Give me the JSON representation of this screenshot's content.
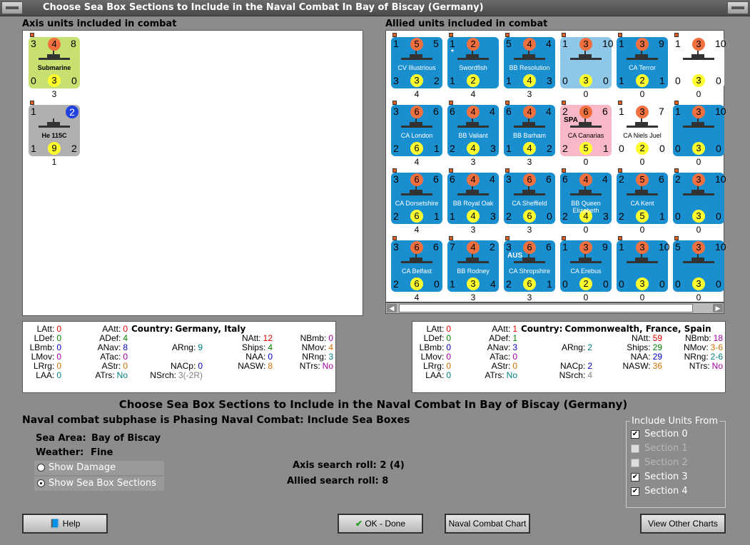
{
  "window": {
    "title": "Choose Sea Box Sections to Include in the Naval Combat In Bay of Biscay (Germany)"
  },
  "axis_panel": {
    "label": "Axis units included in combat",
    "units": [
      {
        "name": "Submarine",
        "tl": "3",
        "tc": "4",
        "tr": "8",
        "bl": "0",
        "bc": "3",
        "br": "0",
        "under": "3",
        "bg": "#c8e070",
        "tc_color": "#f07040",
        "bc_color": "#ffff30",
        "dark": true
      },
      {
        "name": "He 115C",
        "tl": "1",
        "tc": "",
        "tr": "2",
        "bl": "1",
        "bc": "9",
        "br": "2",
        "under": "1",
        "bg": "#b0b0b0",
        "tr_color": "#2040e0",
        "bc_color": "#ffff30",
        "dark": true
      }
    ]
  },
  "allied_panel": {
    "label": "Allied units included in combat",
    "units": [
      {
        "name": "CV Illustrious",
        "tl": "1",
        "tc": "5",
        "tr": "5",
        "bl": "3",
        "bc": "3",
        "br": "2",
        "under": "4",
        "bg": "#1a8fd0"
      },
      {
        "name": "Swordfish",
        "tl": "1",
        "tc": "2",
        "tr": "",
        "bl": "1",
        "bc": "2",
        "br": "",
        "under": "4",
        "bg": "#1a8fd0",
        "tag": "*"
      },
      {
        "name": "BB Resolution",
        "tl": "5",
        "tc": "4",
        "tr": "4",
        "bl": "1",
        "bc": "4",
        "br": "3",
        "under": "3",
        "bg": "#1a8fd0"
      },
      {
        "name": "",
        "tl": "1",
        "tc": "3",
        "tr": "10",
        "bl": "0",
        "bc": "3",
        "br": "0",
        "under": "0",
        "bg": "#8ec7e8"
      },
      {
        "name": "CA Terror",
        "tl": "1",
        "tc": "3",
        "tr": "9",
        "bl": "1",
        "bc": "2",
        "br": "1",
        "under": "0",
        "bg": "#1a8fd0"
      },
      {
        "name": "",
        "tl": "1",
        "tc": "3",
        "tr": "10",
        "bl": "0",
        "bc": "3",
        "br": "0",
        "under": "0",
        "bg": "#ffffff"
      },
      {
        "name": "CA London",
        "tl": "3",
        "tc": "6",
        "tr": "6",
        "bl": "2",
        "bc": "6",
        "br": "1",
        "under": "4",
        "bg": "#1a8fd0"
      },
      {
        "name": "BB Valiant",
        "tl": "6",
        "tc": "4",
        "tr": "4",
        "bl": "2",
        "bc": "4",
        "br": "3",
        "under": "3",
        "bg": "#1a8fd0"
      },
      {
        "name": "BB Barham",
        "tl": "6",
        "tc": "4",
        "tr": "4",
        "bl": "1",
        "bc": "4",
        "br": "2",
        "under": "3",
        "bg": "#1a8fd0"
      },
      {
        "name": "CA Canarias",
        "tl": "2",
        "tc": "6",
        "tr": "6",
        "bl": "2",
        "bc": "5",
        "br": "1",
        "under": "0",
        "bg": "#f8b8c8",
        "tag": "SPA"
      },
      {
        "name": "CA Niels Juel",
        "tl": "1",
        "tc": "3",
        "tr": "7",
        "bl": "0",
        "bc": "2",
        "br": "0",
        "under": "0",
        "bg": "#ffffff"
      },
      {
        "name": "",
        "tl": "1",
        "tc": "3",
        "tr": "10",
        "bl": "0",
        "bc": "3",
        "br": "0",
        "under": "0",
        "bg": "#1a8fd0"
      },
      {
        "name": "CA Dorsetshire",
        "tl": "3",
        "tc": "6",
        "tr": "6",
        "bl": "2",
        "bc": "6",
        "br": "1",
        "under": "4",
        "bg": "#1a8fd0"
      },
      {
        "name": "BB Royal Oak",
        "tl": "6",
        "tc": "4",
        "tr": "4",
        "bl": "1",
        "bc": "4",
        "br": "3",
        "under": "3",
        "bg": "#1a8fd0"
      },
      {
        "name": "CA Sheffield",
        "tl": "3",
        "tc": "6",
        "tr": "6",
        "bl": "2",
        "bc": "6",
        "br": "0",
        "under": "3",
        "bg": "#1a8fd0"
      },
      {
        "name": "BB Queen Elizabeth",
        "tl": "6",
        "tc": "4",
        "tr": "4",
        "bl": "2",
        "bc": "4",
        "br": "3",
        "under": "0",
        "bg": "#1a8fd0"
      },
      {
        "name": "CA Kent",
        "tl": "2",
        "tc": "5",
        "tr": "6",
        "bl": "2",
        "bc": "5",
        "br": "1",
        "under": "0",
        "bg": "#1a8fd0"
      },
      {
        "name": "",
        "tl": "2",
        "tc": "3",
        "tr": "10",
        "bl": "0",
        "bc": "3",
        "br": "0",
        "under": "0",
        "bg": "#1a8fd0"
      },
      {
        "name": "CA Belfast",
        "tl": "3",
        "tc": "6",
        "tr": "6",
        "bl": "2",
        "bc": "6",
        "br": "0",
        "under": "4",
        "bg": "#1a8fd0"
      },
      {
        "name": "BB Rodney",
        "tl": "7",
        "tc": "4",
        "tr": "2",
        "bl": "1",
        "bc": "3",
        "br": "4",
        "under": "3",
        "bg": "#1a8fd0"
      },
      {
        "name": "CA Shropshire",
        "tl": "3",
        "tc": "6",
        "tr": "6",
        "bl": "2",
        "bc": "6",
        "br": "1",
        "under": "3",
        "bg": "#1a8fd0",
        "tag": "AUS"
      },
      {
        "name": "CA Erebus",
        "tl": "1",
        "tc": "3",
        "tr": "9",
        "bl": "0",
        "bc": "2",
        "br": "0",
        "under": "0",
        "bg": "#1a8fd0"
      },
      {
        "name": "",
        "tl": "1",
        "tc": "3",
        "tr": "10",
        "bl": "0",
        "bc": "3",
        "br": "0",
        "under": "0",
        "bg": "#1a8fd0"
      },
      {
        "name": "",
        "tl": "5",
        "tc": "3",
        "tr": "10",
        "bl": "0",
        "bc": "3",
        "br": "0",
        "under": "0",
        "bg": "#1a8fd0"
      }
    ]
  },
  "axis_stats": {
    "country_label": "Country:",
    "country": "Germany, Italy",
    "items": [
      [
        "LAtt:",
        "0"
      ],
      [
        "LDef:",
        "0"
      ],
      [
        "LBmb:",
        "0"
      ],
      [
        "LMov:",
        "0"
      ],
      [
        "LRrg:",
        "0"
      ],
      [
        "LAA:",
        "0"
      ],
      [
        "AAtt:",
        "0"
      ],
      [
        "ADef:",
        "4"
      ],
      [
        "ANav:",
        "8"
      ],
      [
        "ATac:",
        "0"
      ],
      [
        "AStr:",
        "0"
      ],
      [
        "ATrs:",
        "No"
      ],
      [
        "ARng:",
        "9"
      ],
      [
        "NACp:",
        "0"
      ],
      [
        "NSrch:",
        "3(-2R)"
      ],
      [
        "NAtt:",
        "12"
      ],
      [
        "Ships:",
        "4"
      ],
      [
        "NAA:",
        "0"
      ],
      [
        "NASW:",
        "8"
      ],
      [
        "NBmb:",
        "0"
      ],
      [
        "NMov:",
        "4"
      ],
      [
        "NRng:",
        "3"
      ],
      [
        "NTrs:",
        "No"
      ]
    ]
  },
  "allied_stats": {
    "country_label": "Country:",
    "country": "Commonwealth, France, Spain",
    "items": [
      [
        "LAtt:",
        "0"
      ],
      [
        "LDef:",
        "0"
      ],
      [
        "LBmb:",
        "0"
      ],
      [
        "LMov:",
        "0"
      ],
      [
        "LRrg:",
        "0"
      ],
      [
        "LAA:",
        "0"
      ],
      [
        "AAtt:",
        "1"
      ],
      [
        "ADef:",
        "1"
      ],
      [
        "ANav:",
        "3"
      ],
      [
        "ATac:",
        "0"
      ],
      [
        "AStr:",
        "0"
      ],
      [
        "ATrs:",
        "No"
      ],
      [
        "ARng:",
        "2"
      ],
      [
        "NACp:",
        "2"
      ],
      [
        "NSrch:",
        "4"
      ],
      [
        "NAtt:",
        "59"
      ],
      [
        "Ships:",
        "29"
      ],
      [
        "NAA:",
        "29"
      ],
      [
        "NASW:",
        "36"
      ],
      [
        "NBmb:",
        "18"
      ],
      [
        "NMov:",
        "3-6"
      ],
      [
        "NRng:",
        "2-6"
      ],
      [
        "NTrs:",
        "No"
      ]
    ]
  },
  "main": {
    "heading": "Choose Sea Box Sections to Include in the Naval Combat In Bay of Biscay (Germany)",
    "subphase": "Naval combat subphase is Phasing Naval Combat: Include Sea Boxes",
    "sea_area_label": "Sea Area:",
    "sea_area": "Bay of Biscay",
    "weather_label": "Weather:",
    "weather": "Fine",
    "show_damage": "Show Damage",
    "show_sections": "Show Sea Box Sections",
    "axis_roll": "Axis search roll: 2 (4)",
    "allied_roll": "Allied search roll: 8"
  },
  "include": {
    "title": "Include Units From",
    "sections": [
      {
        "label": "Section 0",
        "checked": true,
        "enabled": true
      },
      {
        "label": "Section 1",
        "checked": false,
        "enabled": false
      },
      {
        "label": "Section 2",
        "checked": false,
        "enabled": false
      },
      {
        "label": "Section 3",
        "checked": true,
        "enabled": true
      },
      {
        "label": "Section 4",
        "checked": true,
        "enabled": true
      }
    ]
  },
  "buttons": {
    "help": "Help",
    "ok": "OK - Done",
    "naval_chart": "Naval Combat Chart",
    "other_charts": "View Other Charts"
  },
  "colors": {
    "orange": "#f07040",
    "yellow": "#ffff30",
    "blue_unit": "#1a8fd0",
    "text_red": "#e00000",
    "text_green": "#008000",
    "text_blue": "#0000c0",
    "text_purple": "#a000a0",
    "text_orange": "#d07000",
    "text_teal": "#008080"
  }
}
